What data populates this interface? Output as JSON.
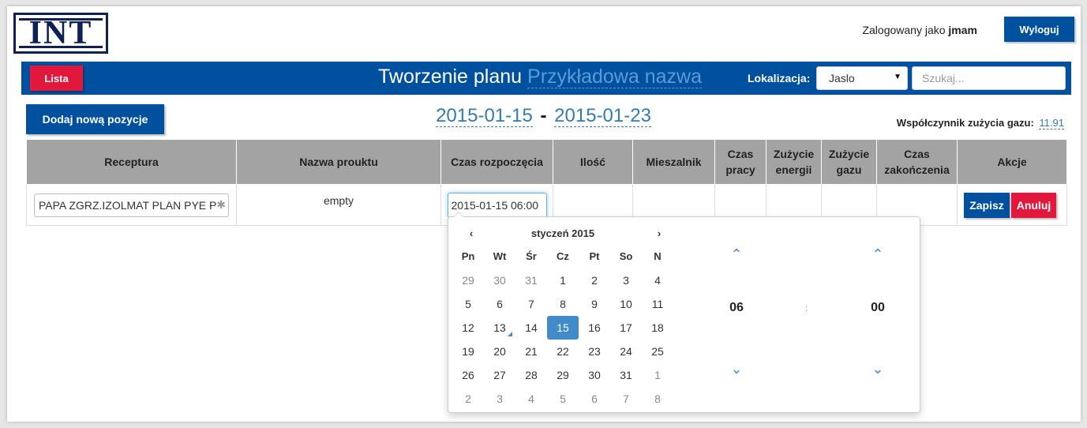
{
  "logo": {
    "text": "INT"
  },
  "user": {
    "prefix": "Zalogowany jako",
    "name": "jmam"
  },
  "buttons": {
    "logout": "Wyloguj",
    "list": "Lista",
    "add_position": "Dodaj nową pozycje",
    "save": "Zapisz",
    "cancel": "Anuluj"
  },
  "header": {
    "title": "Tworzenie planu",
    "plan_name": "Przykładowa nazwa",
    "location_label": "Lokalizacja:",
    "location_value": "Jaslo",
    "search_placeholder": "Szukaj..."
  },
  "dates": {
    "from": "2015-01-15",
    "sep": "-",
    "to": "2015-01-23"
  },
  "gas": {
    "label": "Współczynnik zużycia gazu:",
    "value": "11.91"
  },
  "table": {
    "columns": [
      "Receptura",
      "Nazwa prouktu",
      "Czas rozpoczęcia",
      "Ilość",
      "Mieszalnik",
      "Czas pracy",
      "Zużycie energii",
      "Zużycie gazu",
      "Czas zakończenia",
      "Akcje"
    ],
    "row": {
      "receptura": "PAPA ZGRZ.IZOLMAT PLAN PYE PV",
      "product": "empty",
      "start_time": "2015-01-15 06:00"
    }
  },
  "calendar": {
    "month": "styczeń 2015",
    "prev": "‹",
    "next": "›",
    "weekdays": [
      "Pn",
      "Wt",
      "Śr",
      "Cz",
      "Pt",
      "So",
      "N"
    ],
    "days": [
      "29",
      "30",
      "31",
      "1",
      "2",
      "3",
      "4",
      "5",
      "6",
      "7",
      "8",
      "9",
      "10",
      "11",
      "12",
      "13",
      "14",
      "15",
      "16",
      "17",
      "18",
      "19",
      "20",
      "21",
      "22",
      "23",
      "24",
      "25",
      "26",
      "27",
      "28",
      "29",
      "30",
      "31",
      "1",
      "2",
      "3",
      "4",
      "5",
      "6",
      "7",
      "8"
    ],
    "selected_day": "15",
    "today_day": "13"
  },
  "time": {
    "hours": "06",
    "separator": ":",
    "minutes": "00"
  },
  "colors": {
    "primary": "#0050a0",
    "danger": "#e1173c",
    "link": "#337ab7",
    "selected": "#428bca",
    "table_header": "#a3a3a3"
  }
}
